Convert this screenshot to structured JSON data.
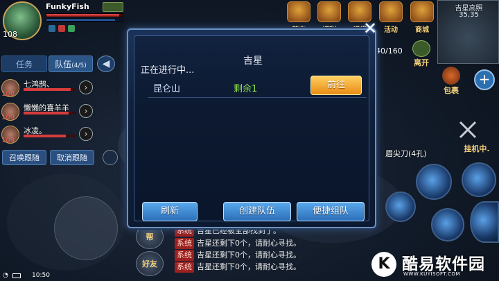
{
  "player": {
    "name": "FunkyFish",
    "level": "108",
    "hp_fraction": 0.95,
    "mp_fraction": 0.9
  },
  "left_panel": {
    "tab_task": "任务",
    "tab_team": "队伍",
    "tab_team_count": "(4/5)",
    "members": [
      {
        "name": "七鸿鹄、",
        "level": "108",
        "hp_fraction": 0.9
      },
      {
        "name": "懒懒的喜羊羊",
        "level": "109",
        "hp_fraction": 0.85
      },
      {
        "name": "冰凌。",
        "level": "109",
        "hp_fraction": 0.8
      }
    ],
    "summon_follow": "召唤跟随",
    "cancel_follow": "取消跟随"
  },
  "top_icons": [
    {
      "label": "首充",
      "icon": "first-charge-icon"
    },
    {
      "label": "福利",
      "icon": "welfare-icon"
    },
    {
      "label": "福袋",
      "icon": "gift-icon"
    },
    {
      "label": "活动",
      "icon": "activity-icon"
    },
    {
      "label": "商城",
      "icon": "shop-icon"
    }
  ],
  "minimap": {
    "location": "吉星高照",
    "coords": "35,35"
  },
  "bag_count": "40/160",
  "leave_label": "离开",
  "bag_label": "包裹",
  "auto_battle_label": "挂机中.",
  "weapon_label": "眉尖刀(4孔)",
  "chat": {
    "tag": "系统",
    "lines": [
      "吉星已经被全部找到了。",
      "吉星还剩下0个，请耐心寻找。",
      "吉星还剩下0个，请耐心寻找。",
      "吉星还剩下0个，请耐心寻找。"
    ],
    "side_buttons": [
      "帮",
      "好友"
    ]
  },
  "status_bar": {
    "time": "10:50"
  },
  "dialog": {
    "title": "吉星",
    "status": "正在进行中...",
    "task_name": "昆仑山",
    "task_remain": "剩余1",
    "go_label": "前往",
    "refresh_label": "刷新",
    "create_team_label": "创建队伍",
    "quick_team_label": "便捷组队",
    "close_glyph": "✕"
  },
  "watermark": {
    "logo_letter": "K",
    "name": "酷易软件园",
    "url": "WWW.KUYISOFT.COM"
  }
}
